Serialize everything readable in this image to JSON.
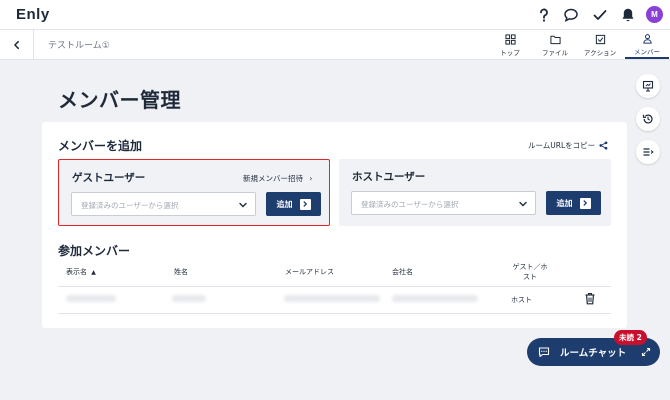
{
  "app": {
    "logo": "Enly"
  },
  "topbar": {
    "avatar_initial": "M"
  },
  "subbar": {
    "room_name": "テストルーム①",
    "tabs": [
      {
        "label": "トップ",
        "icon": "grid-icon"
      },
      {
        "label": "ファイル",
        "icon": "folder-icon"
      },
      {
        "label": "アクション",
        "icon": "checkbox-icon"
      },
      {
        "label": "メンバー",
        "icon": "person-icon",
        "active": true
      }
    ]
  },
  "page": {
    "title": "メンバー管理"
  },
  "add_section": {
    "title": "メンバーを追加",
    "copy_url_label": "ルームURLをコピー",
    "guest": {
      "title": "ゲストユーザー",
      "invite_link": "新規メンバー招待",
      "placeholder": "登録済みのユーザーから選択",
      "add_label": "追加"
    },
    "host": {
      "title": "ホストユーザー",
      "placeholder": "登録済みのユーザーから選択",
      "add_label": "追加"
    }
  },
  "members_section": {
    "title": "参加メンバー",
    "columns": [
      "表示名",
      "姓名",
      "メールアドレス",
      "会社名",
      "ゲスト／ホスト"
    ],
    "rows": [
      {
        "role": "ホスト"
      }
    ]
  },
  "chat": {
    "label": "ルームチャット",
    "unread_badge": "未読 2"
  },
  "colors": {
    "primary": "#1d3d6e",
    "highlight": "#e0262b",
    "badge": "#c8102e",
    "avatar": "#8a3fd6"
  }
}
